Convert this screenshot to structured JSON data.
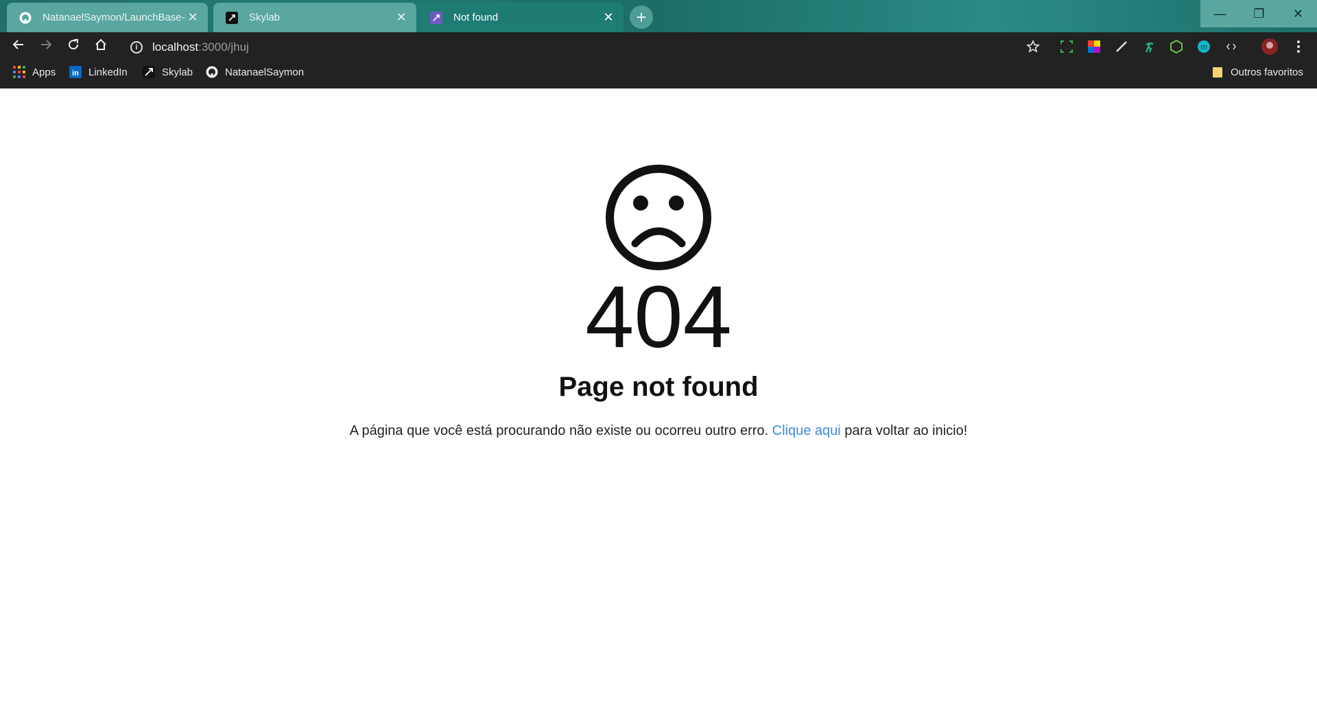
{
  "browser": {
    "tabs": [
      {
        "title": "NatanaelSaymon/LaunchBase-Bo",
        "favicon": "github-icon",
        "active": false
      },
      {
        "title": "Skylab",
        "favicon": "rocketseat-icon",
        "active": false
      },
      {
        "title": "Not found",
        "favicon": "rocketseat-purple-icon",
        "active": true
      }
    ],
    "close_glyph": "✕",
    "new_tab_glyph": "+",
    "window_controls": {
      "minimize": "—",
      "restore": "❐",
      "close": "✕"
    }
  },
  "toolbar": {
    "url_host": "localhost",
    "url_path": ":3000/jhuj",
    "info_glyph": "i"
  },
  "bookmarks": {
    "items": [
      {
        "label": "Apps",
        "icon": "apps-grid-icon"
      },
      {
        "label": "LinkedIn",
        "icon": "linkedin-icon"
      },
      {
        "label": "Skylab",
        "icon": "rocketseat-icon"
      },
      {
        "label": "NatanaelSaymon",
        "icon": "github-icon"
      }
    ],
    "other": {
      "label": "Outros favoritos",
      "icon": "folder-icon"
    }
  },
  "page": {
    "error_code": "404",
    "heading": "Page not found",
    "message_before": "A página que você está procurando não existe ou ocorreu outro erro. ",
    "link_text": "Clique aqui",
    "message_after": " para voltar ao inicio!"
  },
  "colors": {
    "tabstrip": "#1f6f6a",
    "toolbar": "#222222",
    "link": "#3d8bd9"
  }
}
